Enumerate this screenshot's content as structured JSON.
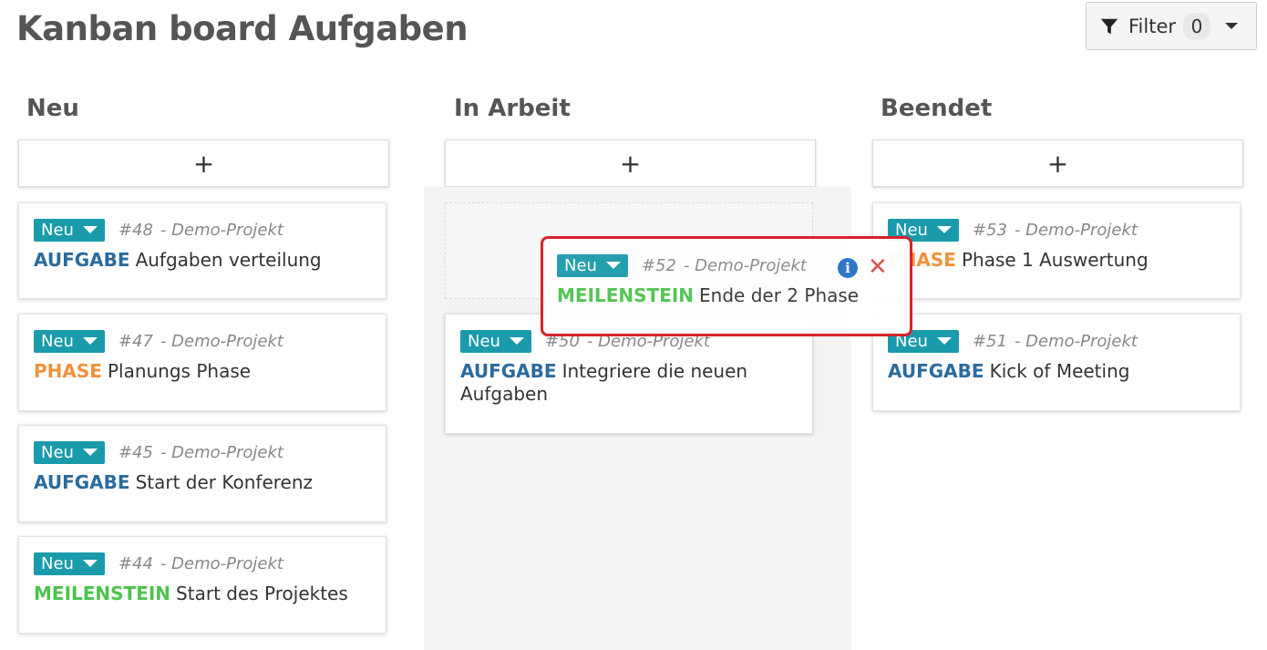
{
  "page": {
    "title": "Kanban board Aufgaben"
  },
  "filter": {
    "label": "Filter",
    "count": "0"
  },
  "add_label": "+",
  "columns": [
    {
      "title": "Neu",
      "cards": [
        {
          "status": "Neu",
          "number": "#48",
          "project": "- Demo-Projekt",
          "kind": "AUFGABE",
          "title": "Aufgaben verteilung"
        },
        {
          "status": "Neu",
          "number": "#47",
          "project": "- Demo-Projekt",
          "kind": "PHASE",
          "title": "Planungs Phase"
        },
        {
          "status": "Neu",
          "number": "#45",
          "project": "- Demo-Projekt",
          "kind": "AUFGABE",
          "title": "Start der Konferenz"
        },
        {
          "status": "Neu",
          "number": "#44",
          "project": "- Demo-Projekt",
          "kind": "MEILENSTEIN",
          "title": "Start des Projektes"
        }
      ]
    },
    {
      "title": "In Arbeit",
      "cards": [
        {
          "status": "Neu",
          "number": "#50",
          "project": "- Demo-Projekt",
          "kind": "AUFGABE",
          "title": "Integriere die neuen Aufgaben"
        }
      ]
    },
    {
      "title": "Beendet",
      "cards": [
        {
          "status": "Neu",
          "number": "#53",
          "project": "- Demo-Projekt",
          "kind": "PHASE",
          "title": "Phase 1 Auswertung"
        },
        {
          "status": "Neu",
          "number": "#51",
          "project": "- Demo-Projekt",
          "kind": "AUFGABE",
          "title": "Kick of Meeting"
        }
      ]
    }
  ],
  "dragging": {
    "status": "Neu",
    "number": "#52",
    "project": "- Demo-Projekt",
    "kind": "MEILENSTEIN",
    "title": "Ende der 2 Phase",
    "info_glyph": "i",
    "close_glyph": "✕"
  },
  "colors": {
    "status_badge": "#1a9bab",
    "aufgabe": "#2b6b9e",
    "phase": "#f0923a",
    "meilenstein": "#4cc34c",
    "highlight": "#d8232a"
  }
}
